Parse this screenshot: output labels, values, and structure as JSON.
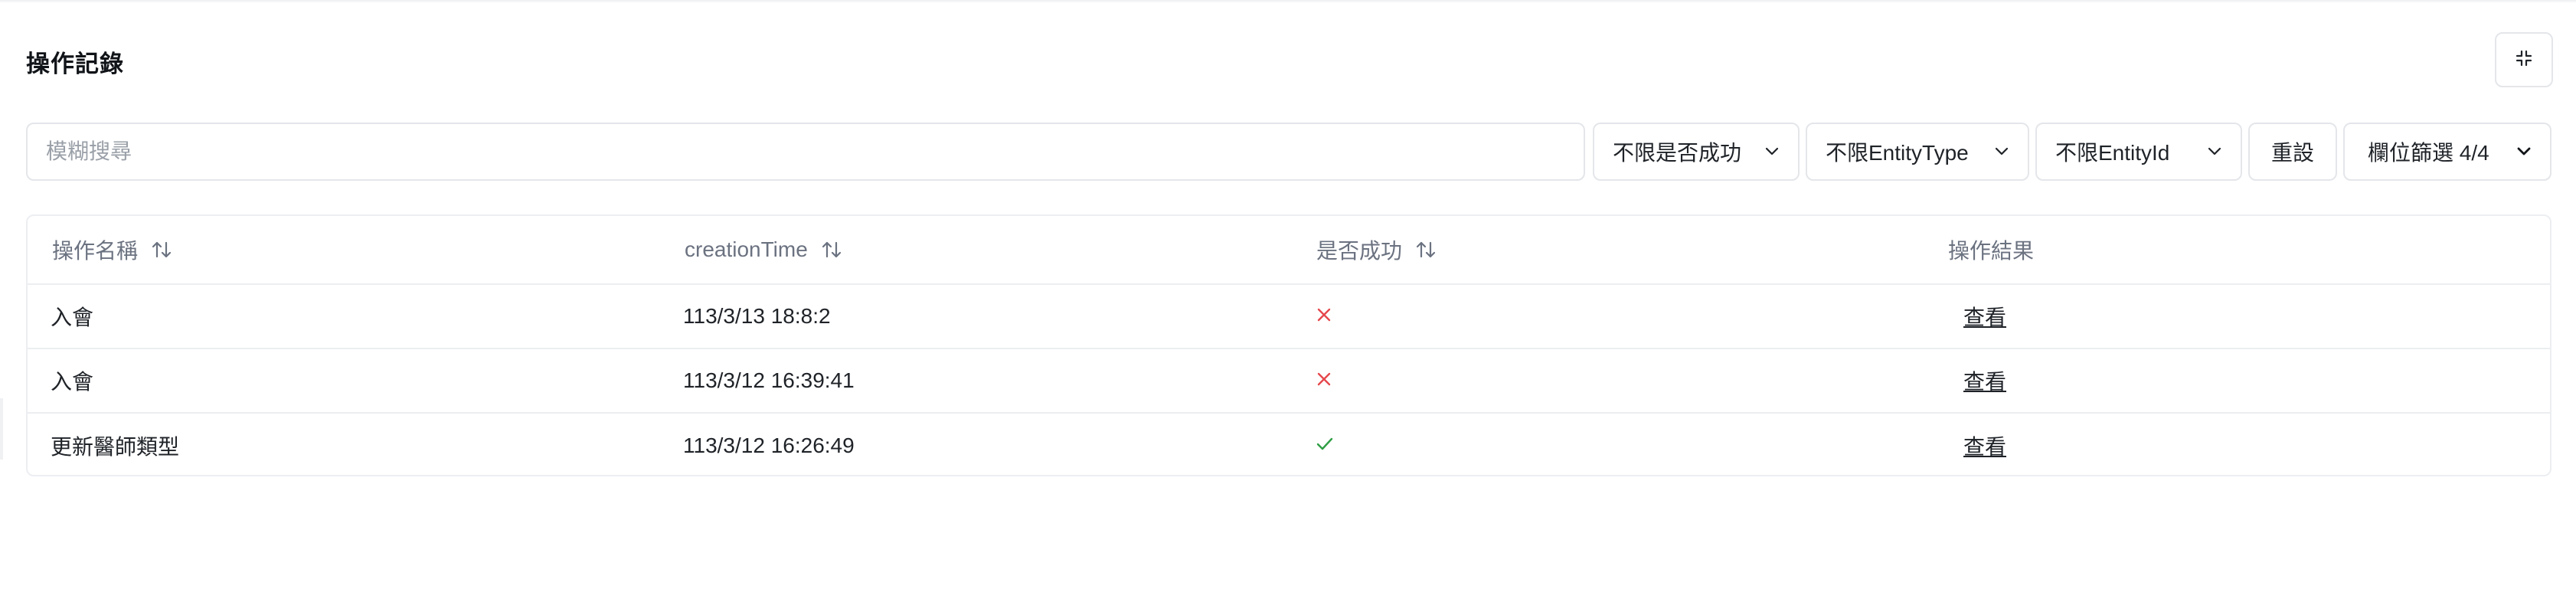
{
  "page": {
    "title": "操作記錄",
    "collapse_icon": "collapse-icon"
  },
  "filters": {
    "search_placeholder": "模糊搜尋",
    "search_value": "",
    "success_select": "不限是否成功",
    "entity_type_select": "不限EntityType",
    "entity_id_select": "不限EntityId",
    "reset_label": "重設",
    "column_filter_label": "欄位篩選 4/4"
  },
  "table": {
    "columns": [
      {
        "label": "操作名稱",
        "sortable": true
      },
      {
        "label": "creationTime",
        "sortable": true
      },
      {
        "label": "是否成功",
        "sortable": true
      },
      {
        "label": "操作結果",
        "sortable": false
      }
    ],
    "rows": [
      {
        "name": "入會",
        "time": "113/3/13 18:8:2",
        "success": false,
        "result_link": "查看"
      },
      {
        "name": "入會",
        "time": "113/3/12 16:39:41",
        "success": false,
        "result_link": "查看"
      },
      {
        "name": "更新醫師類型",
        "time": "113/3/12 16:26:49",
        "success": true,
        "result_link": "查看"
      }
    ]
  },
  "colors": {
    "fail": "#e5484d",
    "success": "#2f9e44",
    "border": "#e4e6ea",
    "muted_text": "#6b7280"
  }
}
